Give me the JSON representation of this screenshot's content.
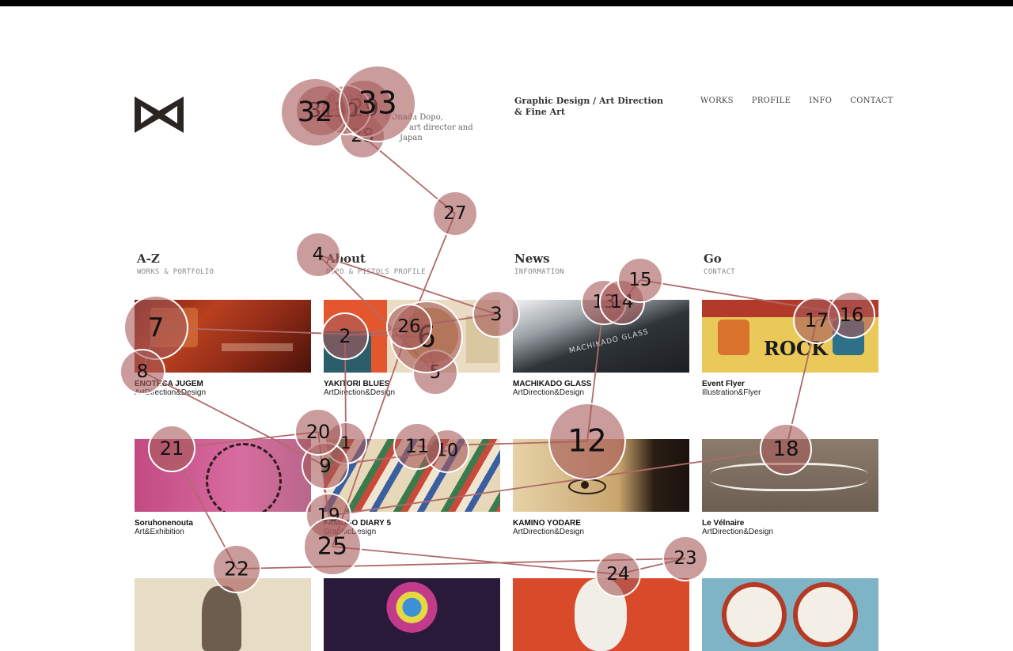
{
  "colors": {
    "accent": "#b06a6a",
    "fixation_fill": "#a65a5a",
    "text": "#222222"
  },
  "header": {
    "brand_name": "OPOPO",
    "brand_desc": [
      "I Onada Dopo,",
      "art director and",
      "Japan"
    ],
    "tagline": [
      "Graphic Design / Art Direction",
      "& Fine Art"
    ]
  },
  "nav": [
    "WORKS",
    "PROFILE",
    "INFO",
    "CONTACT"
  ],
  "sections": [
    {
      "title": "A-Z",
      "sub": "WORKS & PORTFOLIO"
    },
    {
      "title": "About",
      "sub": "DOPO & PISTOLS PROFILE"
    },
    {
      "title": "News",
      "sub": "INFORMATION"
    },
    {
      "title": "Go",
      "sub": "CONTACT"
    }
  ],
  "works": [
    {
      "title": "ENOTECA JUGEM",
      "category": "ArtDirection&Design"
    },
    {
      "title": "YAKITORI BLUES",
      "category": "ArtDirection&Design"
    },
    {
      "title": "MACHIKADO GLASS",
      "category": "ArtDirection&Design"
    },
    {
      "title": "Event Flyer",
      "category": "Illustration&Flyer"
    },
    {
      "title": "Soruhonenouta",
      "category": "Art&Exhibition"
    },
    {
      "title": "FAMOSO DIARY 5",
      "category": "GraphicDesign"
    },
    {
      "title": "KAMINO YODARE",
      "category": "ArtDirection&Design"
    },
    {
      "title": "Le Vélnaire",
      "category": "ArtDirection&Design"
    },
    {
      "title": "",
      "category": ""
    },
    {
      "title": "",
      "category": ""
    },
    {
      "title": "",
      "category": ""
    },
    {
      "title": "",
      "category": ""
    }
  ],
  "image_text": {
    "machikado_sign": "MACHIKADO GLASS",
    "rock_flyer": "ROCK"
  },
  "fixations": [
    {
      "label": "1"
    },
    {
      "label": "2"
    },
    {
      "label": "3"
    },
    {
      "label": "4"
    },
    {
      "label": "5"
    },
    {
      "label": "6"
    },
    {
      "label": "7"
    },
    {
      "label": "8"
    },
    {
      "label": "9"
    },
    {
      "label": "10"
    },
    {
      "label": "11"
    },
    {
      "label": "12"
    },
    {
      "label": "13"
    },
    {
      "label": "14"
    },
    {
      "label": "15"
    },
    {
      "label": "16"
    },
    {
      "label": "17"
    },
    {
      "label": "18"
    },
    {
      "label": "19"
    },
    {
      "label": "20"
    },
    {
      "label": "21"
    },
    {
      "label": "22"
    },
    {
      "label": "23"
    },
    {
      "label": "24"
    },
    {
      "label": "25"
    },
    {
      "label": "26"
    },
    {
      "label": "27"
    },
    {
      "label": "28"
    },
    {
      "label": "29"
    },
    {
      "label": "30"
    },
    {
      "label": "31"
    },
    {
      "label": "32"
    },
    {
      "label": "33"
    }
  ]
}
